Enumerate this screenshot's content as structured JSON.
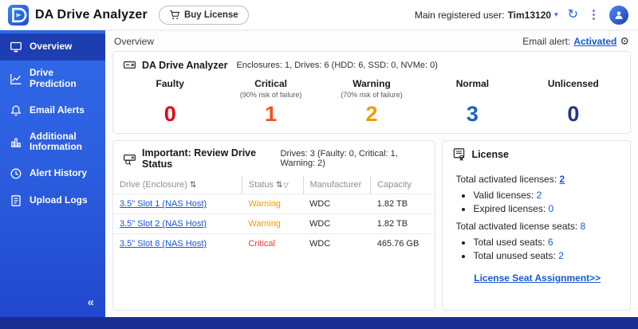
{
  "header": {
    "app_title": "DA Drive Analyzer",
    "buy_license": "Buy License",
    "user_label": "Main registered user:",
    "user_name": "Tim13120"
  },
  "icons": {
    "refresh": "↻",
    "menu": "⋮",
    "caret": "▾",
    "gear": "⚙",
    "sort": "⇅",
    "filter": "▽",
    "collapse": "«"
  },
  "sidebar": {
    "items": [
      {
        "label": "Overview"
      },
      {
        "label": "Drive Prediction"
      },
      {
        "label": "Email Alerts"
      },
      {
        "label": "Additional Information"
      },
      {
        "label": "Alert History"
      },
      {
        "label": "Upload Logs"
      }
    ]
  },
  "topbar": {
    "title": "Overview",
    "email_alert_label": "Email alert:",
    "email_alert_status": "Activated"
  },
  "summary": {
    "title": "DA Drive Analyzer",
    "subtitle": "Enclosures: 1, Drives: 6 (HDD: 6, SSD: 0, NVMe: 0)",
    "stats": [
      {
        "label": "Faulty",
        "sub": "",
        "value": "0",
        "color": "#e8001c"
      },
      {
        "label": "Critical",
        "sub": "(90% risk of failure)",
        "value": "1",
        "color": "#f4511e"
      },
      {
        "label": "Warning",
        "sub": "(70% risk of failure)",
        "value": "2",
        "color": "#f59a00"
      },
      {
        "label": "Normal",
        "sub": "",
        "value": "3",
        "color": "#1565c0"
      },
      {
        "label": "Unlicensed",
        "sub": "",
        "value": "0",
        "color": "#27357e"
      }
    ]
  },
  "drive_status": {
    "title": "Important: Review Drive Status",
    "subtitle": "Drives: 3 (Faulty: 0, Critical: 1, Warning: 2)",
    "columns": {
      "drive": "Drive (Enclosure)",
      "status": "Status",
      "manufacturer": "Manufacturer",
      "capacity": "Capacity"
    },
    "rows": [
      {
        "drive": "3.5\" Slot 1 (NAS Host)",
        "status": "Warning",
        "status_color": "#f59a00",
        "manufacturer": "WDC",
        "capacity": "1.82 TB"
      },
      {
        "drive": "3.5\" Slot 2 (NAS Host)",
        "status": "Warning",
        "status_color": "#f59a00",
        "manufacturer": "WDC",
        "capacity": "1.82 TB"
      },
      {
        "drive": "3.5\" Slot 8 (NAS Host)",
        "status": "Critical",
        "status_color": "#e53935",
        "manufacturer": "WDC",
        "capacity": "465.76 GB"
      }
    ]
  },
  "license": {
    "title": "License",
    "activated_label": "Total activated licenses:",
    "activated_value": "2",
    "bullets1": [
      {
        "label": "Valid licenses:",
        "value": "2"
      },
      {
        "label": "Expired licenses:",
        "value": "0"
      }
    ],
    "seats_label": "Total activated license seats:",
    "seats_value": "8",
    "bullets2": [
      {
        "label": "Total used seats:",
        "value": "6"
      },
      {
        "label": "Total unused seats:",
        "value": "2"
      }
    ],
    "assignment_link": "License Seat Assignment>>"
  },
  "colors": {
    "accent": "#2563eb",
    "footer": "#1b2d91"
  }
}
